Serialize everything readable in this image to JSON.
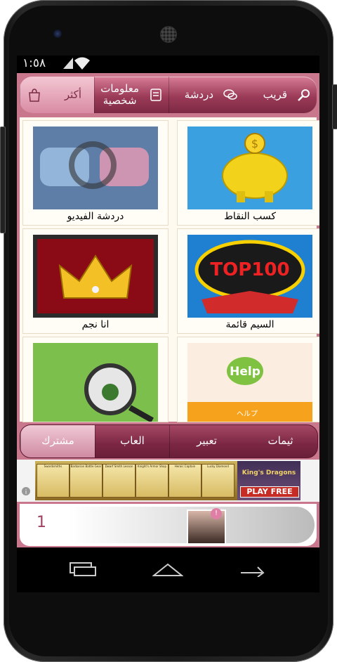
{
  "status": {
    "time": "١:٥٨"
  },
  "top_nav": [
    {
      "label": "أكثر",
      "icon": "shopping-bag-icon",
      "active": true
    },
    {
      "label": "معلومات\nشخصية",
      "icon": "profile-card-icon",
      "active": false
    },
    {
      "label": "دردشة",
      "icon": "chat-bubbles-icon",
      "active": false
    },
    {
      "label": "قريب",
      "icon": "search-icon",
      "active": false
    }
  ],
  "grid": [
    {
      "label": "كسب النقاط",
      "icon": "piggy-bank-coin-icon"
    },
    {
      "label": "دردشة الفيديو",
      "icon": "video-chat-people-icon"
    },
    {
      "label": "السيم قائمة",
      "icon": "top100-stars-icon",
      "image_text": "TOP100"
    },
    {
      "label": "انا نجم",
      "icon": "crown-icon"
    },
    {
      "label": "",
      "icon": "help-speech-bubble-icon",
      "image_text": "Help",
      "subtext": "ヘルプ"
    },
    {
      "label": "",
      "icon": "paw-magnifier-icon"
    }
  ],
  "bottom_tabs": [
    {
      "label": "ثيمات",
      "active": false
    },
    {
      "label": "تعبير",
      "active": false
    },
    {
      "label": "العاب",
      "active": false
    },
    {
      "label": "مشترك",
      "active": true
    }
  ],
  "ad": {
    "cards": [
      "Swordsmiths",
      "Barbarian Battle Gear",
      "Dwarf Smith Lesson",
      "Knight's Armor Shop",
      "Heroic Captain",
      "Lucky Diamond"
    ],
    "brand": "King's Dragons",
    "cta": "PLAY FREE"
  },
  "promo": {
    "number": "1",
    "badge": "!"
  },
  "colors": {
    "accent": "#9b3b58",
    "tab_active": "#d98ba3",
    "background": "#c9778d"
  }
}
